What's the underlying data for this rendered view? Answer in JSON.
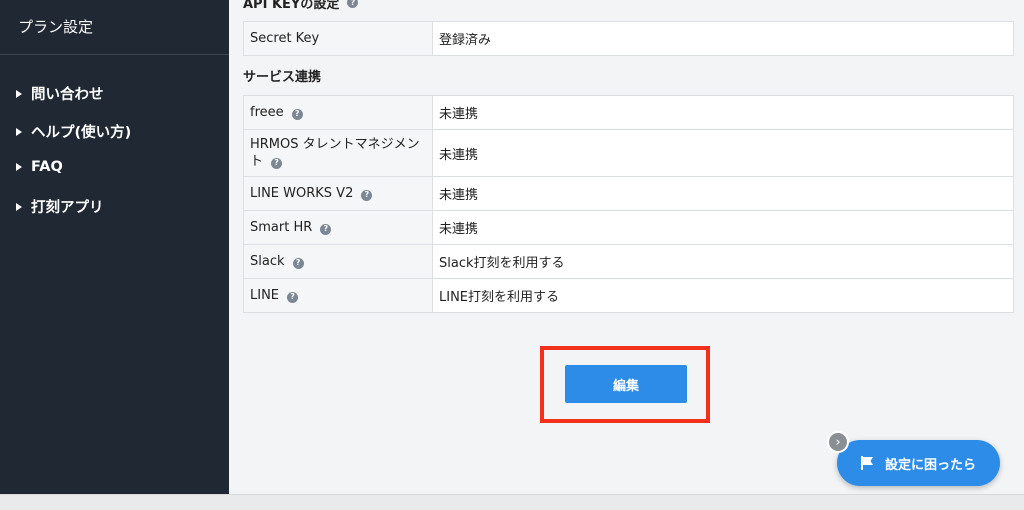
{
  "sidebar": {
    "title": "プラン設定",
    "items": [
      {
        "label": "問い合わせ"
      },
      {
        "label": "ヘルプ(使い方)"
      },
      {
        "label": "FAQ"
      },
      {
        "label": "打刻アプリ"
      }
    ]
  },
  "api_section": {
    "title": "API KEYの設定",
    "rows": [
      {
        "key": "Secret Key",
        "value": "登録済み"
      }
    ]
  },
  "service_section": {
    "title": "サービス連携",
    "rows": [
      {
        "key": "freee",
        "value": "未連携"
      },
      {
        "key": "HRMOS タレントマネジメント",
        "value": "未連携"
      },
      {
        "key": "LINE WORKS V2",
        "value": "未連携"
      },
      {
        "key": "Smart HR",
        "value": "未連携"
      },
      {
        "key": "Slack",
        "value": "Slack打刻を利用する"
      },
      {
        "key": "LINE",
        "value": "LINE打刻を利用する"
      }
    ]
  },
  "edit_button": {
    "label": "編集"
  },
  "help_fab": {
    "label": "設定に困ったら",
    "icon": "flag-icon"
  },
  "help_icon_glyph": "?",
  "collapse_glyph": "›",
  "colors": {
    "sidebar_bg": "#1f2833",
    "accent": "#2d8ce8",
    "highlight": "#f2301b"
  }
}
